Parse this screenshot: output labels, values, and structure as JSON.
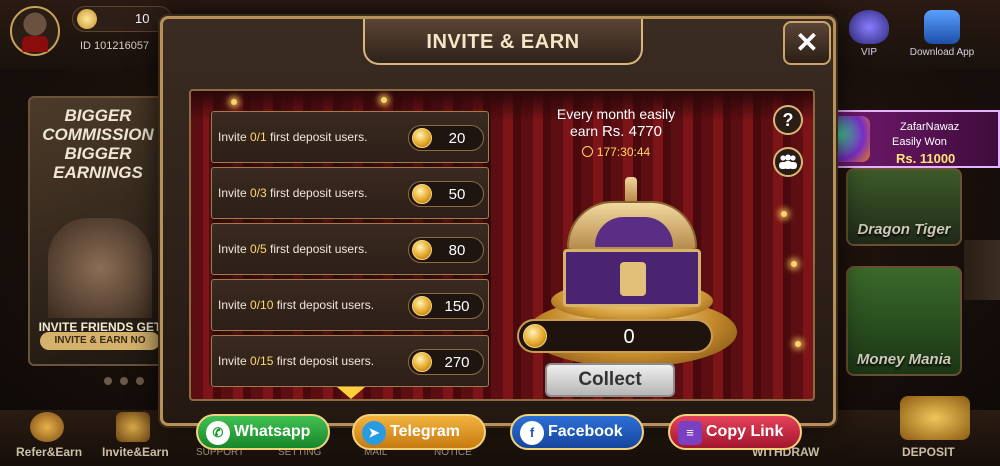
{
  "lobby": {
    "balance": "10",
    "player_id": "ID  101216057",
    "vip_label": "VIP",
    "download_label": "Download App",
    "promo": {
      "headline": "BIGGER COMMISSION BIGGER EARNINGS",
      "subline": "INVITE FRIENDS GET UNLIMITED B",
      "button": "INVITE & EARN NO"
    },
    "games": [
      "Dragon Tiger",
      "Money Mania"
    ],
    "bottom_nav": {
      "refer": "Refer&Earn",
      "invite": "Invite&Earn",
      "support": "SUPPORT",
      "setting": "SETTING",
      "mail": "MAIL",
      "notice": "NOTICE",
      "withdraw": "WITHDRAW",
      "deposit": "DEPOSIT"
    }
  },
  "notification": {
    "name": "ZafarNawaz",
    "message": "Easily Won",
    "amount": "Rs. 11000"
  },
  "modal": {
    "title": "INVITE & EARN",
    "close_glyph": "✕",
    "tasks": [
      {
        "prefix": "Invite ",
        "count": "0/1",
        "suffix": " first deposit users.",
        "reward": "20"
      },
      {
        "prefix": "Invite ",
        "count": "0/3",
        "suffix": " first deposit users.",
        "reward": "50"
      },
      {
        "prefix": "Invite ",
        "count": "0/5",
        "suffix": " first deposit users.",
        "reward": "80"
      },
      {
        "prefix": "Invite ",
        "count": "0/10",
        "suffix": " first deposit users.",
        "reward": "150"
      },
      {
        "prefix": "Invite ",
        "count": "0/15",
        "suffix": " first deposit users.",
        "reward": "270"
      }
    ],
    "earn_line1": "Every month easily",
    "earn_line2_prefix": "earn ",
    "earn_amount": "Rs. 4770",
    "countdown": "177:30:44",
    "help_glyph": "?",
    "collected_total": "0",
    "collect_label": "Collect"
  },
  "share": {
    "whatsapp": "Whatsapp",
    "telegram": "Telegram",
    "facebook": "Facebook",
    "copy_link": "Copy Link"
  },
  "icons": [
    "whatsapp-icon",
    "telegram-icon",
    "facebook-icon",
    "copy-icon",
    "clock-icon",
    "help-icon",
    "group-icon",
    "coin-icon",
    "close-icon",
    "treasure-chest-icon"
  ]
}
